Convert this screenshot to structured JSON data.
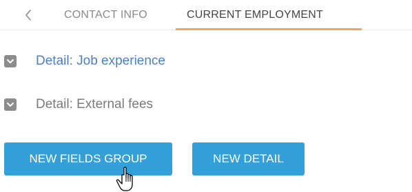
{
  "tabs": {
    "back_icon": "chevron-left-icon",
    "items": [
      {
        "label": "CONTACT INFO",
        "active": false
      },
      {
        "label": "CURRENT EMPLOYMENT",
        "active": true
      }
    ],
    "active_underline_color": "#f0a360"
  },
  "details": [
    {
      "label": "Detail: Job experience",
      "icon": "chevron-down-icon",
      "state": "highlighted"
    },
    {
      "label": "Detail: External fees",
      "icon": "chevron-down-icon",
      "state": "normal"
    }
  ],
  "buttons": {
    "new_fields_group": "NEW FIELDS GROUP",
    "new_detail": "NEW DETAIL",
    "color": "#33a0d9"
  },
  "cursor": {
    "icon": "hand-pointer-icon"
  },
  "colors": {
    "link_blue": "#4a7fc9",
    "muted_text": "#7a7a7a",
    "chevron_box": "#8c8c8c"
  }
}
